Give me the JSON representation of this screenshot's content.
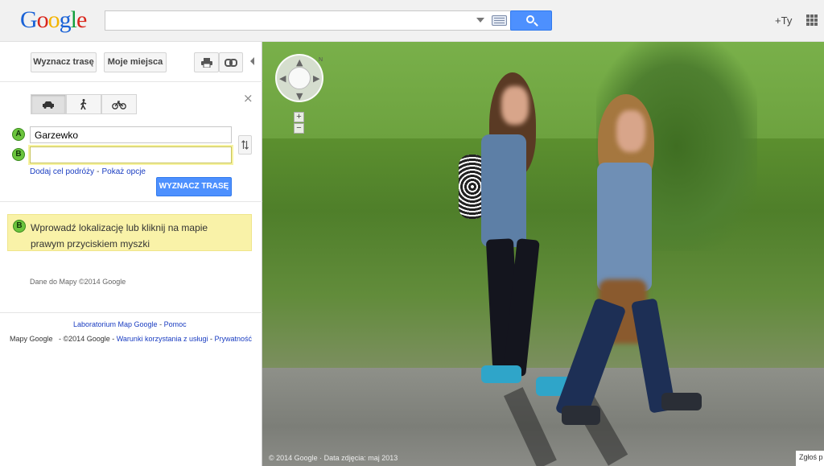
{
  "header": {
    "logo_letters": [
      "G",
      "o",
      "o",
      "g",
      "l",
      "e"
    ],
    "logo_colors": [
      "#1a62d6",
      "#d9261c",
      "#f4b400",
      "#1a62d6",
      "#119e3c",
      "#d9261c"
    ],
    "search_value": "",
    "account_label": "+Ty",
    "accent": "#4d90fe"
  },
  "toolbar": {
    "directions_label": "Wyznacz trasę",
    "my_places_label": "Moje miejsca",
    "print_icon": "printer-icon",
    "link_icon": "link-icon"
  },
  "directions": {
    "modes": [
      "car",
      "walk",
      "bike"
    ],
    "active_mode": "car",
    "point_a_marker": "A",
    "point_a_value": "Garzewko",
    "point_b_marker": "B",
    "point_b_value": "",
    "add_destination_link": "Dodaj cel podróży",
    "separator": "-",
    "show_options_link": "Pokaż opcje",
    "submit_label": "WYZNACZ TRASĘ"
  },
  "hint": {
    "marker": "B",
    "text": "Wprowadź lokalizację lub kliknij na mapie prawym przyciskiem myszki"
  },
  "map_data_credit": "Dane do Mapy ©2014 Google",
  "footer": {
    "labs_link": "Laboratorium Map Google",
    "help_link": "Pomoc",
    "dash": "-",
    "brand": "Mapy Google",
    "copyright": "- ©2014 Google",
    "terms_link": "Warunki korzystania z usługi",
    "privacy_link": "Prywatność"
  },
  "streetview": {
    "compass_label": "N",
    "zoom_in": "+",
    "zoom_out": "−",
    "credit": "© 2014 Google · Data zdjęcia: maj 2013",
    "report_label": "Zgłoś p"
  }
}
